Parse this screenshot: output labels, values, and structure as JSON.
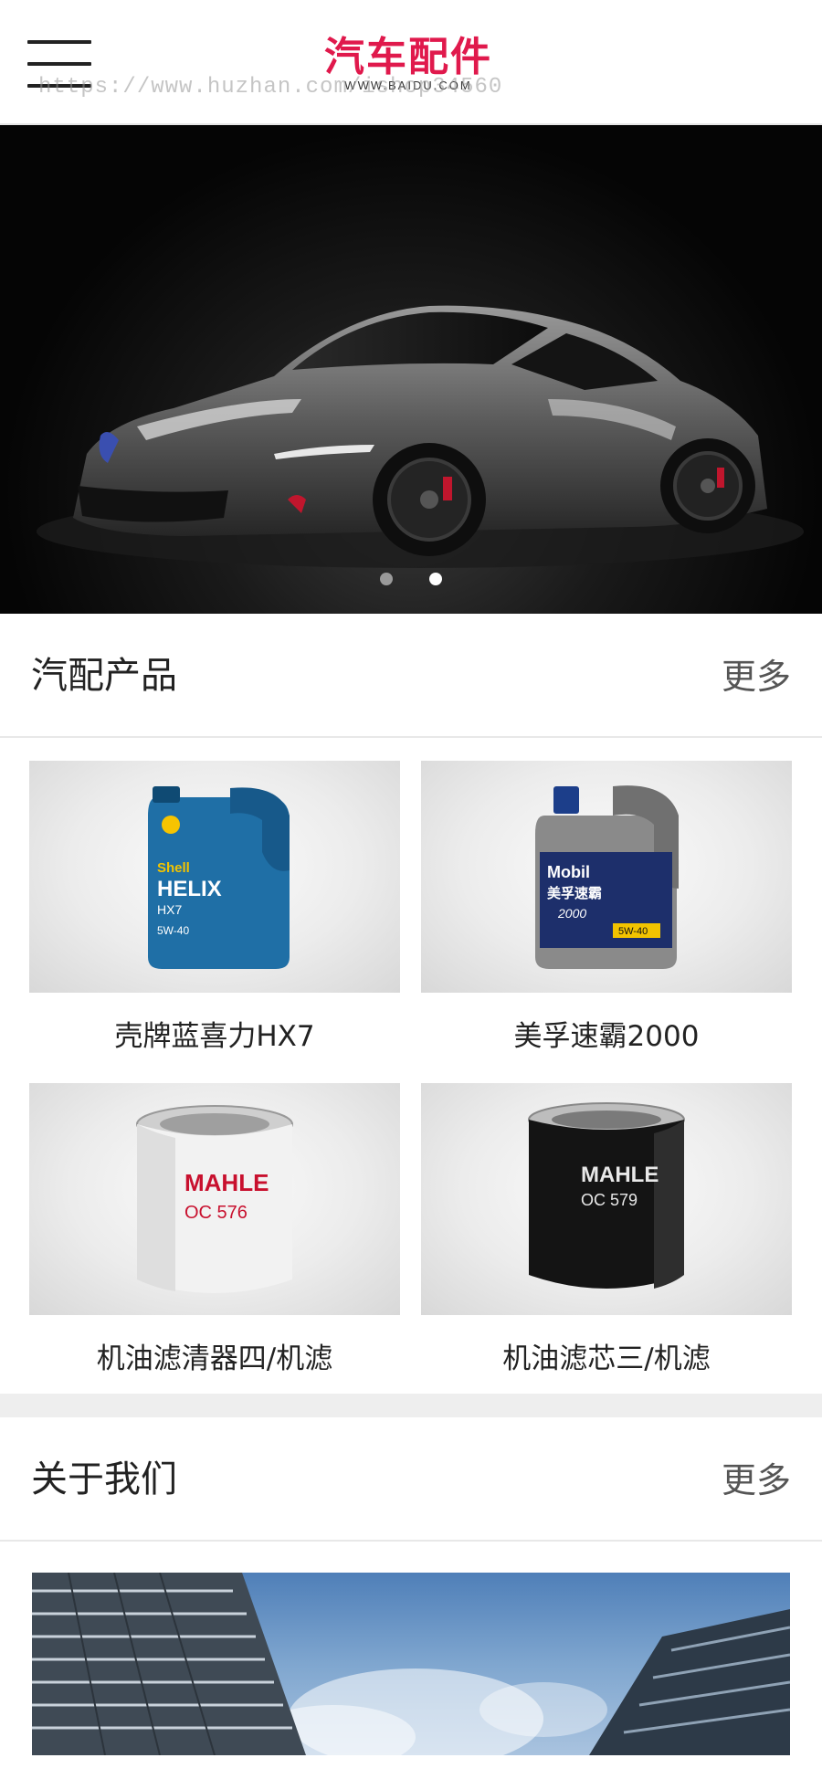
{
  "header": {
    "logo_title": "汽车配件",
    "logo_sub": "WWW.BAIDU.COM",
    "watermark": "https://www.huzhan.com/ishop34560"
  },
  "banner": {
    "slides": 2,
    "active_slide": 2,
    "dot_active_color": "#ffffff",
    "dot_inactive_color": "#9a9a9a"
  },
  "products_section": {
    "title": "汽配产品",
    "more_label": "更多",
    "items": [
      {
        "name": "壳牌蓝喜力HX7",
        "icon": "shell-helix-oil-bottle"
      },
      {
        "name": "美孚速霸2000",
        "icon": "mobil-oil-bottle"
      },
      {
        "name": "机油滤清器四/机滤",
        "icon": "mahle-oc576-oil-filter"
      },
      {
        "name": "机油滤芯三/机滤",
        "icon": "mahle-oc579-oil-filter"
      }
    ]
  },
  "about_section": {
    "title": "关于我们",
    "more_label": "更多"
  },
  "colors": {
    "brand": "#e0194c",
    "divider": "#e8e8e8",
    "band": "#eeeeee"
  }
}
